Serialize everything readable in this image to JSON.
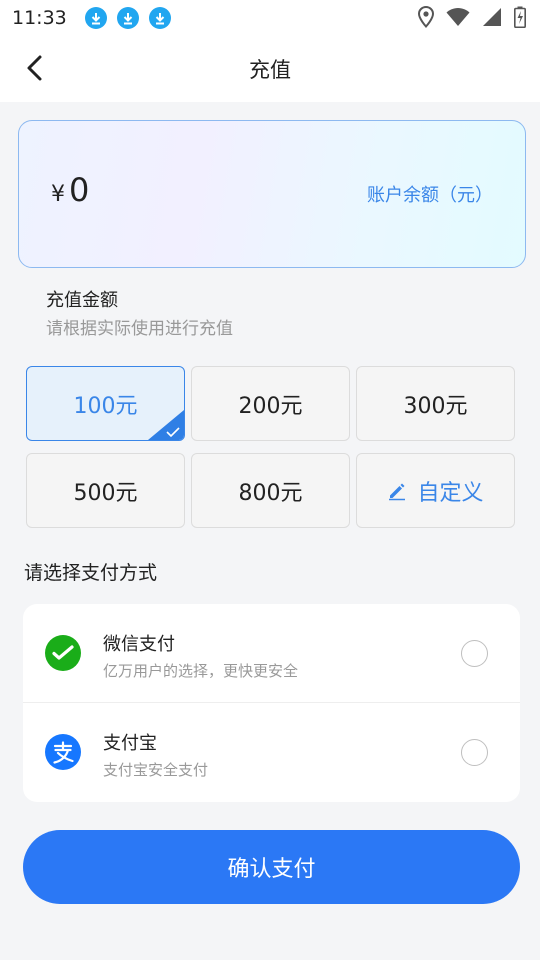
{
  "status_bar": {
    "time": "11:33"
  },
  "header": {
    "title": "充值"
  },
  "balance": {
    "currency": "¥",
    "amount": "0",
    "label": "账户余额（元）"
  },
  "recharge": {
    "title": "充值金额",
    "subtitle": "请根据实际使用进行充值",
    "options": [
      "100元",
      "200元",
      "300元",
      "500元",
      "800元"
    ],
    "selected": "100元",
    "custom_label": "自定义"
  },
  "payment": {
    "title": "请选择支付方式",
    "methods": [
      {
        "name": "微信支付",
        "desc": "亿万用户的选择，更快更安全"
      },
      {
        "name": "支付宝",
        "desc": "支付宝安全支付"
      }
    ]
  },
  "confirm_label": "确认支付",
  "colors": {
    "accent": "#2b78f5",
    "wechat": "#1aad19",
    "alipay": "#1677ff"
  },
  "icons": [
    "download-icon",
    "location-icon",
    "wifi-icon",
    "signal-icon",
    "battery-icon",
    "back-icon",
    "edit-icon",
    "wechat-pay-icon",
    "alipay-icon"
  ]
}
